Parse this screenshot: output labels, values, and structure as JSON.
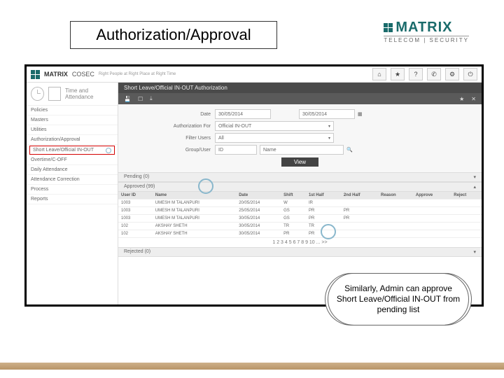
{
  "slide": {
    "title": "Authorization/Approval",
    "logo": {
      "name": "MATRIX",
      "sub": "TELECOM | SECURITY"
    },
    "callout": "Similarly, Admin can approve Short Leave/Official IN-OUT from pending list"
  },
  "app": {
    "header": {
      "brand": "MATRIX",
      "product": "COSEC",
      "tagline": "Right People at Right Place at Right Time"
    },
    "sidebar": {
      "title": "Time and Attendance",
      "items": [
        "Policies",
        "Masters",
        "Utilities",
        "Authorization/Approval",
        "Short Leave/Official IN-OUT",
        "Overtime/C-OFF",
        "Daily Attendance",
        "Attendance Correction",
        "Process",
        "Reports"
      ]
    },
    "page": {
      "title": "Short Leave/Official IN-OUT Authorization"
    },
    "form": {
      "date_label": "Date",
      "date_from": "30/05/2014",
      "date_to": "30/05/2014",
      "auth_for_label": "Authorization For",
      "auth_for_value": "Official IN-OUT",
      "filter_users_label": "Filter Users",
      "filter_users_value": "All",
      "group_user_label": "Group/User",
      "group_id_placeholder": "ID",
      "group_name_placeholder": "Name",
      "view_button": "View"
    },
    "sections": {
      "pending": "Pending (0)",
      "approved": "Approved (99)",
      "rejected": "Rejected (0)"
    },
    "table": {
      "cols": [
        "User ID",
        "Name",
        "Date",
        "Shift",
        "1st Half",
        "2nd Half",
        "Reason",
        "Approve",
        "Reject"
      ],
      "rows": [
        [
          "1003",
          "UMESH M TALANPURI",
          "20/05/2014",
          "W",
          "IR",
          "",
          ""
        ],
        [
          "1003",
          "UMESH M TALANPURI",
          "25/05/2014",
          "GS",
          "PR",
          "PR"
        ],
        [
          "1003",
          "UMESH M TALANPURI",
          "30/05/2014",
          "GS",
          "PR",
          "PR"
        ],
        [
          "102",
          "AKSHAY SHETH",
          "30/05/2014",
          "TR",
          "TR",
          ""
        ],
        [
          "102",
          "AKSHAY SHETH",
          "30/05/2014",
          "PR",
          "PR",
          ""
        ]
      ],
      "pager": "1 2 3 4 5 6 7 8 9 10 ... >>"
    }
  }
}
